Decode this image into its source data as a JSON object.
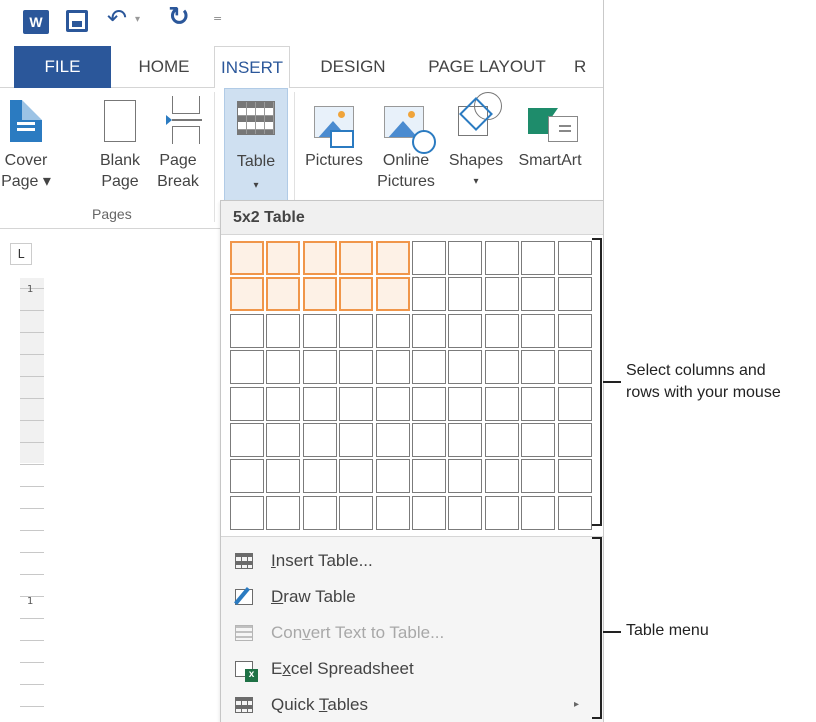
{
  "qat": {
    "word_logo": "W",
    "undo_glyph": "↶",
    "redo_glyph": "↻",
    "dropdown_glyph": "▾",
    "qat_glyph": "="
  },
  "tabs": {
    "file": "FILE",
    "home": "HOME",
    "insert": "INSERT",
    "design": "DESIGN",
    "page_layout": "PAGE LAYOUT",
    "more": "R"
  },
  "ribbon": {
    "cover_page": {
      "line1": "Cover",
      "line2": "Page ▾"
    },
    "blank_page": {
      "line1": "Blank",
      "line2": "Page"
    },
    "page_break": {
      "line1": "Page",
      "line2": "Break"
    },
    "pages_group": "Pages",
    "table": {
      "line1": "Table",
      "dropdown": "▾"
    },
    "pictures": {
      "line1": "Pictures"
    },
    "online_pictures": {
      "line1": "Online",
      "line2": "Pictures"
    },
    "shapes": {
      "line1": "Shapes",
      "dropdown": "▾"
    },
    "smartart": {
      "line1": "SmartArt"
    }
  },
  "ruler": {
    "corner": "L",
    "mark1": "1",
    "mark2": "1"
  },
  "table_dropdown": {
    "header": "5x2 Table",
    "grid": {
      "columns": 10,
      "rows": 8,
      "selected_columns": 5,
      "selected_rows": 2
    },
    "menu": [
      {
        "pre": "",
        "ul": "I",
        "post": "nsert Table...",
        "icon": "table-icon",
        "disabled": false,
        "submenu": false
      },
      {
        "pre": "",
        "ul": "D",
        "post": "raw Table",
        "icon": "draw-table-icon",
        "disabled": false,
        "submenu": false
      },
      {
        "pre": "Con",
        "ul": "v",
        "post": "ert Text to Table...",
        "icon": "convert-text-icon",
        "disabled": true,
        "submenu": false
      },
      {
        "pre": "E",
        "ul": "x",
        "post": "cel Spreadsheet",
        "icon": "excel-icon",
        "disabled": false,
        "submenu": false
      },
      {
        "pre": "Quick ",
        "ul": "T",
        "post": "ables",
        "icon": "quick-tables-icon",
        "disabled": false,
        "submenu": true,
        "arrow": "▸"
      }
    ]
  },
  "callouts": {
    "grid_line1": "Select columns and",
    "grid_line2": "rows with your mouse",
    "menu": "Table menu"
  },
  "colors": {
    "brand_blue": "#2b579a",
    "selection_orange": "#f0964a",
    "table_button_bg": "#cfe0f1"
  }
}
